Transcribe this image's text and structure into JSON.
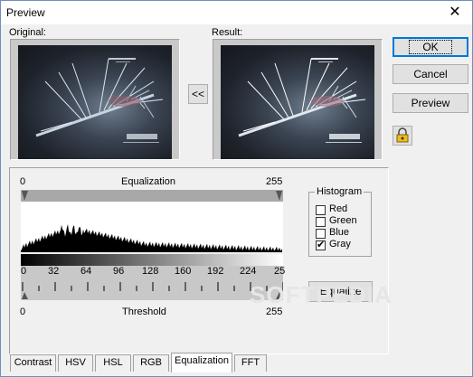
{
  "window": {
    "title": "Preview"
  },
  "labels": {
    "original": "Original:",
    "result": "Result:"
  },
  "buttons": {
    "copy": "<<",
    "ok": "OK",
    "cancel": "Cancel",
    "preview": "Preview",
    "equalize": "Equalize"
  },
  "equalization": {
    "header": "Equalization",
    "min_label": "0",
    "max_label": "255",
    "threshold_label": "Threshold",
    "threshold_min": "0",
    "threshold_max": "255",
    "scale_ticks": [
      "0",
      "32",
      "64",
      "96",
      "128",
      "160",
      "192",
      "224",
      "25"
    ]
  },
  "histogram_group": {
    "title": "Histogram",
    "channels": [
      {
        "label": "Red",
        "checked": false
      },
      {
        "label": "Green",
        "checked": false
      },
      {
        "label": "Blue",
        "checked": false
      },
      {
        "label": "Gray",
        "checked": true
      }
    ]
  },
  "tabs": [
    {
      "label": "Contrast",
      "active": false
    },
    {
      "label": "HSV",
      "active": false
    },
    {
      "label": "HSL",
      "active": false
    },
    {
      "label": "RGB",
      "active": false
    },
    {
      "label": "Equalization",
      "active": true
    },
    {
      "label": "FFT",
      "active": false
    }
  ],
  "watermark": "SOFTPEDIA"
}
